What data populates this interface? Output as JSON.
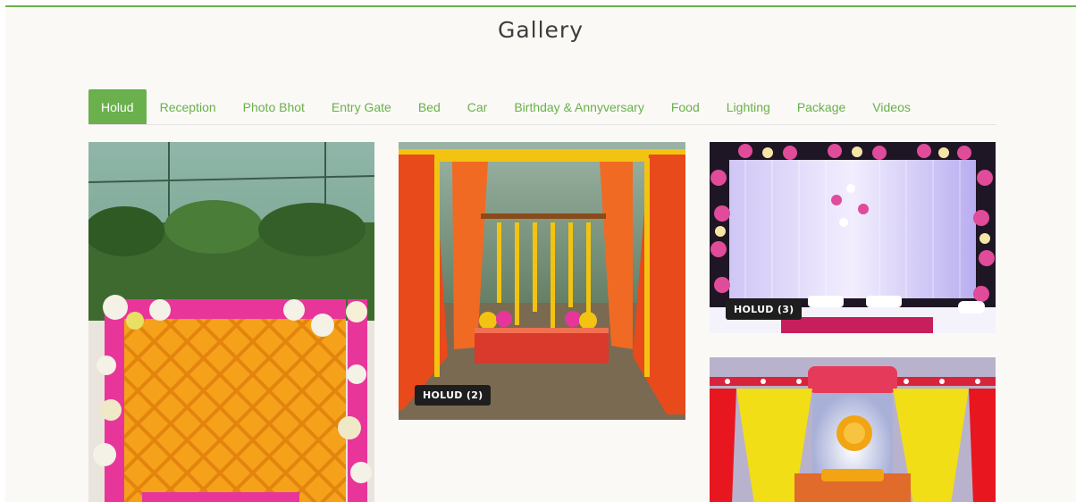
{
  "page": {
    "title": "Gallery"
  },
  "tabs": [
    {
      "label": "Holud",
      "active": true
    },
    {
      "label": "Reception"
    },
    {
      "label": "Photo Bhot"
    },
    {
      "label": "Entry Gate"
    },
    {
      "label": "Bed"
    },
    {
      "label": "Car"
    },
    {
      "label": "Birthday & Annyversary"
    },
    {
      "label": "Food"
    },
    {
      "label": "Lighting"
    },
    {
      "label": "Package"
    },
    {
      "label": "Videos"
    }
  ],
  "gallery": {
    "items": [
      {
        "caption": ""
      },
      {
        "caption": "HOLUD (2)"
      },
      {
        "caption": "HOLUD (3)"
      },
      {
        "caption": ""
      }
    ]
  },
  "colors": {
    "accent": "#6ab04c",
    "badge_bg": "#1e1e1e"
  }
}
